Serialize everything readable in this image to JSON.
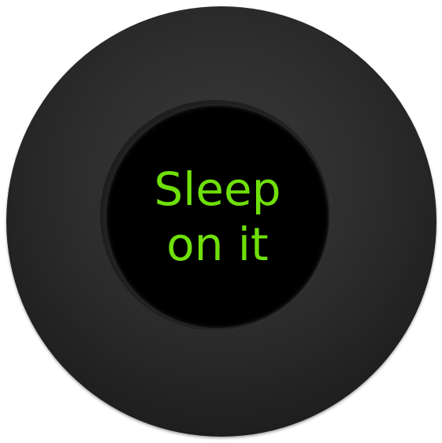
{
  "magic_ball": {
    "answer_lines": [
      "Sleep",
      "on it"
    ],
    "colors": {
      "ball": "#2c2c2c",
      "window": "#000000",
      "answer_text": "#6fe00a"
    }
  }
}
